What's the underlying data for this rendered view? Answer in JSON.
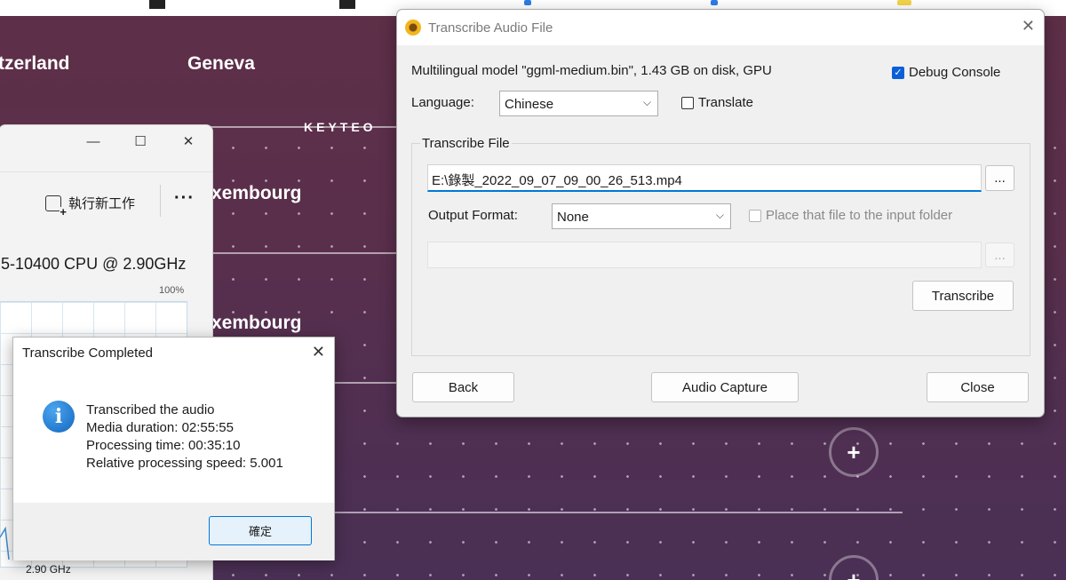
{
  "background": {
    "cities": [
      "tzerland",
      "Geneva",
      "xembourg",
      "xembourg"
    ],
    "brand": "KEYTEO",
    "plus_symbol": "+"
  },
  "task_manager": {
    "minimize_symbol": "—",
    "maximize_symbol": "☐",
    "close_symbol": "✕",
    "run_new_task": "執行新工作",
    "more_symbol": "···",
    "cpu_name": "5-10400 CPU @ 2.90GHz",
    "utilization_max": "100%",
    "speed": "2.90 GHz"
  },
  "completed_dialog": {
    "title": "Transcribe Completed",
    "close_symbol": "✕",
    "info_symbol": "i",
    "lines": [
      "Transcribed the audio",
      "Media duration: 02:55:55",
      "Processing time: 00:35:10",
      "Relative processing speed: 5.001"
    ],
    "ok_label": "確定"
  },
  "transcribe_window": {
    "title": "Transcribe Audio File",
    "close_symbol": "✕",
    "model_info": "Multilingual model \"ggml-medium.bin\", 1.43 GB on disk, GPU",
    "debug_console": {
      "label": "Debug Console",
      "checked": true,
      "check_symbol": "✓"
    },
    "language_label": "Language:",
    "language_value": "Chinese",
    "translate": {
      "label": "Translate",
      "checked": false
    },
    "group_title": "Transcribe File",
    "input_path": "E:\\錄製_2022_09_07_09_00_26_513.mp4",
    "browse_label": "...",
    "output_format_label": "Output Format:",
    "output_format_value": "None",
    "place_in_input_folder": {
      "label": "Place that file to the input folder",
      "checked": false
    },
    "output_path": "",
    "output_browse_label": "...",
    "transcribe_label": "Transcribe",
    "back_label": "Back",
    "audio_capture_label": "Audio Capture",
    "close_label": "Close",
    "chevron_symbol": "⌵"
  }
}
